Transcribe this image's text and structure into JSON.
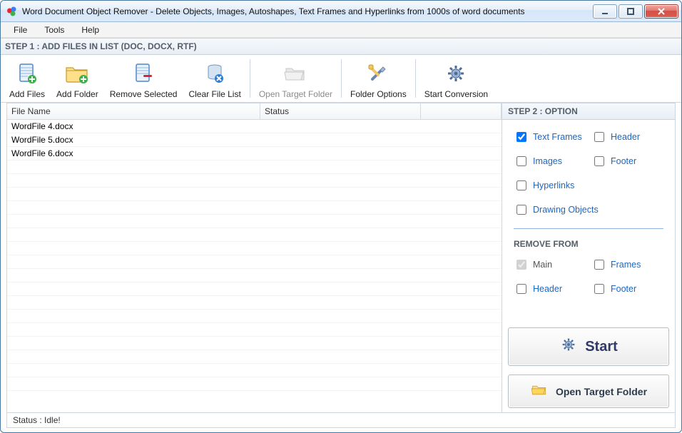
{
  "window": {
    "title": "Word Document Object Remover - Delete Objects, Images, Autoshapes, Text Frames and Hyperlinks from 1000s of word documents"
  },
  "menubar": {
    "items": [
      "File",
      "Tools",
      "Help"
    ]
  },
  "step1": {
    "header": "STEP 1 : ADD FILES IN LIST (DOC, DOCX, RTF)"
  },
  "toolbar": {
    "add_files": "Add Files",
    "add_folder": "Add Folder",
    "remove_selected": "Remove Selected",
    "clear_file_list": "Clear File List",
    "open_target_folder": "Open Target Folder",
    "folder_options": "Folder Options",
    "start_conversion": "Start Conversion"
  },
  "filelist": {
    "columns": {
      "filename": "File Name",
      "status": "Status"
    },
    "rows": [
      {
        "filename": "WordFile 4.docx",
        "status": ""
      },
      {
        "filename": "WordFile 5.docx",
        "status": ""
      },
      {
        "filename": "WordFile 6.docx",
        "status": ""
      }
    ]
  },
  "step2": {
    "header": "STEP 2 : OPTION",
    "options": {
      "text_frames": {
        "label": "Text Frames",
        "checked": true
      },
      "header": {
        "label": "Header",
        "checked": false
      },
      "images": {
        "label": "Images",
        "checked": false
      },
      "footer": {
        "label": "Footer",
        "checked": false
      },
      "hyperlinks": {
        "label": "Hyperlinks",
        "checked": false
      },
      "drawing_objects": {
        "label": "Drawing Objects",
        "checked": false
      }
    },
    "remove_from_title": "REMOVE FROM",
    "remove_from": {
      "main": {
        "label": "Main",
        "checked": true,
        "disabled": true
      },
      "frames": {
        "label": "Frames",
        "checked": false
      },
      "header": {
        "label": "Header",
        "checked": false
      },
      "footer": {
        "label": "Footer",
        "checked": false
      }
    },
    "start_label": "Start",
    "open_target_label": "Open Target Folder"
  },
  "statusbar": {
    "text": "Status  :  Idle!"
  }
}
